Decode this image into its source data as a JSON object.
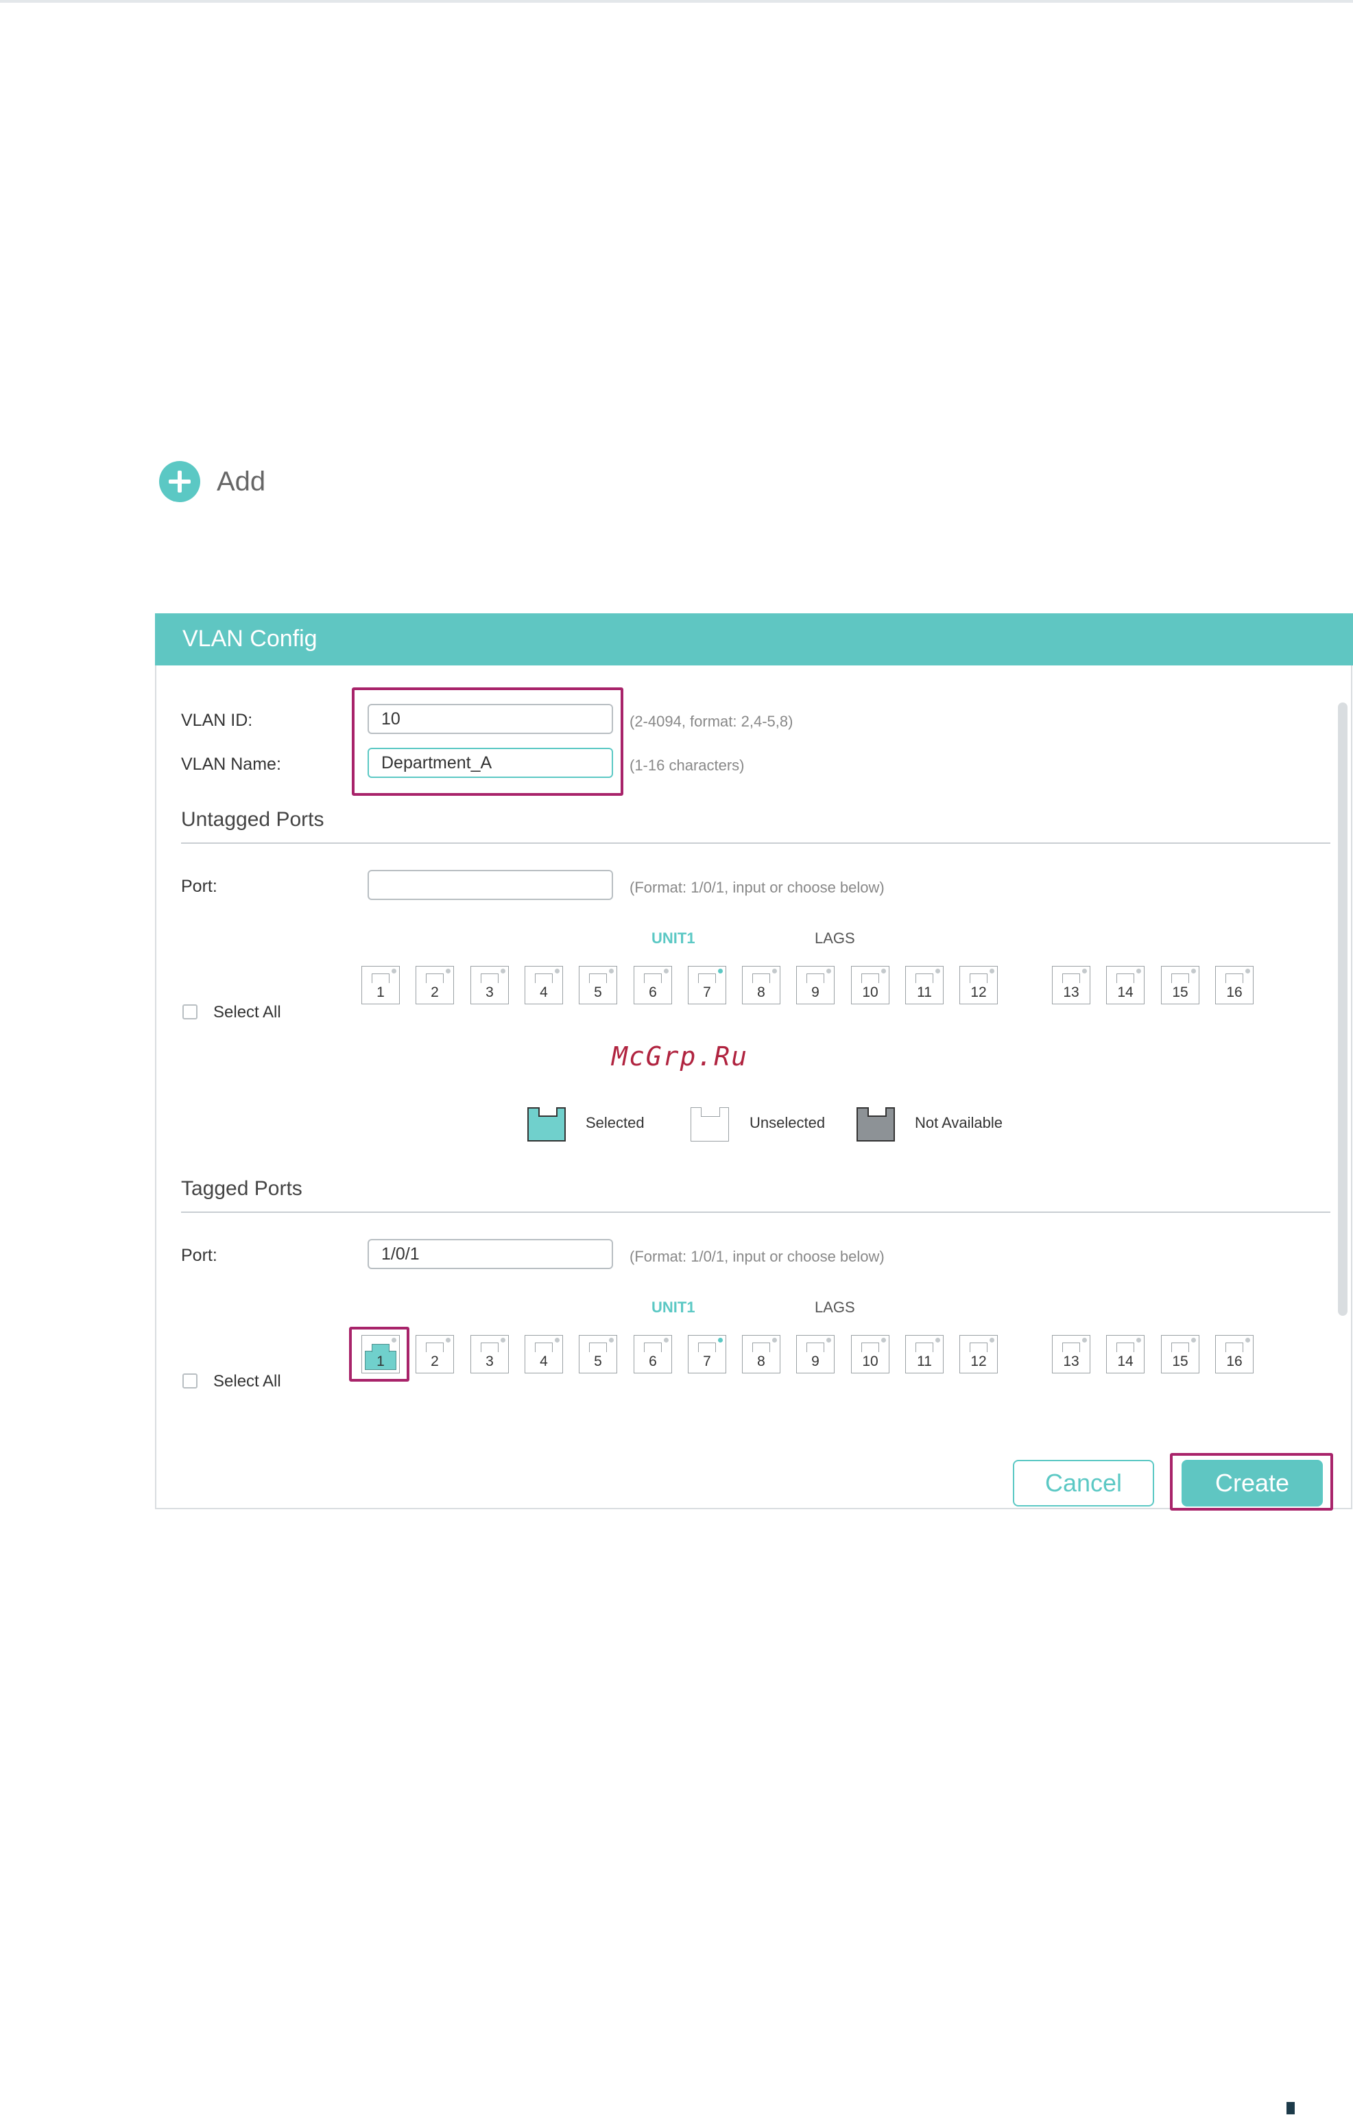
{
  "add": {
    "label": "Add",
    "icon": "plus-circle-icon"
  },
  "panel": {
    "title": "VLAN Config"
  },
  "vlan_id": {
    "label": "VLAN ID:",
    "value": "10",
    "hint": "(2-4094, format: 2,4-5,8)"
  },
  "vlan_name": {
    "label": "VLAN Name:",
    "value": "Department_A",
    "hint": "(1-16 characters)"
  },
  "untagged": {
    "title": "Untagged Ports",
    "port_label": "Port:",
    "port_value": "",
    "port_hint": "(Format: 1/0/1, input or choose below)",
    "unit_label": "UNIT1",
    "lags_label": "LAGS",
    "select_all": "Select All",
    "ports": [
      "1",
      "2",
      "3",
      "4",
      "5",
      "6",
      "7",
      "8",
      "9",
      "10",
      "11",
      "12"
    ],
    "lags": [
      "13",
      "14",
      "15",
      "16"
    ],
    "selected": []
  },
  "legend": {
    "selected": "Selected",
    "unselected": "Unselected",
    "not_available": "Not Available"
  },
  "watermark": "McGrp.Ru",
  "tagged": {
    "title": "Tagged Ports",
    "port_label": "Port:",
    "port_value": "1/0/1",
    "port_hint": "(Format: 1/0/1, input or choose below)",
    "unit_label": "UNIT1",
    "lags_label": "LAGS",
    "select_all": "Select All",
    "ports": [
      "1",
      "2",
      "3",
      "4",
      "5",
      "6",
      "7",
      "8",
      "9",
      "10",
      "11",
      "12"
    ],
    "lags": [
      "13",
      "14",
      "15",
      "16"
    ],
    "selected": [
      "1"
    ]
  },
  "buttons": {
    "cancel": "Cancel",
    "create": "Create"
  },
  "colors": {
    "accent": "#5fc6c2",
    "highlight": "#a8236a"
  }
}
